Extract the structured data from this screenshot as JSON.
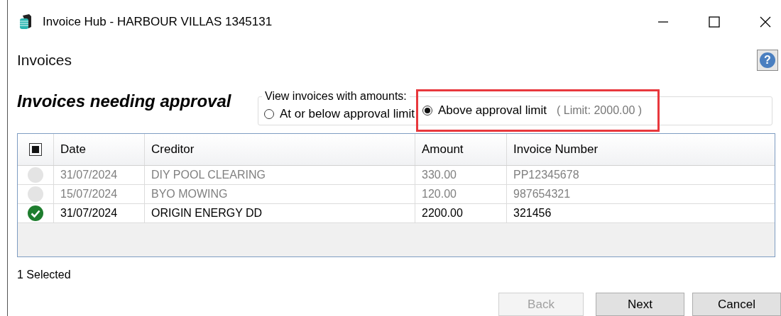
{
  "window": {
    "title": "Invoice Hub - HARBOUR VILLAS 1345131"
  },
  "page_title": "Invoices",
  "help_button": {
    "label": "?"
  },
  "heading": "Invoices needing approval",
  "filter": {
    "legend": "View invoices with amounts:",
    "options": [
      {
        "label": "At or below approval limit",
        "selected": false
      },
      {
        "label": "Above approval limit",
        "selected": true,
        "highlighted": true
      }
    ],
    "limit_note": "( Limit:  2000.00 )"
  },
  "table": {
    "select_all": {
      "checked": true
    },
    "columns": [
      "Date",
      "Creditor",
      "Amount",
      "Invoice Number"
    ],
    "rows": [
      {
        "selected": false,
        "cells": [
          "31/07/2024",
          "DIY POOL CLEARING",
          "330.00",
          "PP12345678"
        ]
      },
      {
        "selected": false,
        "cells": [
          "15/07/2024",
          "BYO MOWING",
          "120.00",
          "987654321"
        ]
      },
      {
        "selected": true,
        "cells": [
          "31/07/2024",
          "ORIGIN ENERGY DD",
          "2200.00",
          "321456"
        ]
      }
    ]
  },
  "status": "1 Selected",
  "buttons": [
    {
      "label": "Back",
      "disabled": true
    },
    {
      "label": "Next",
      "disabled": false
    },
    {
      "label": "Cancel",
      "disabled": false
    }
  ]
}
